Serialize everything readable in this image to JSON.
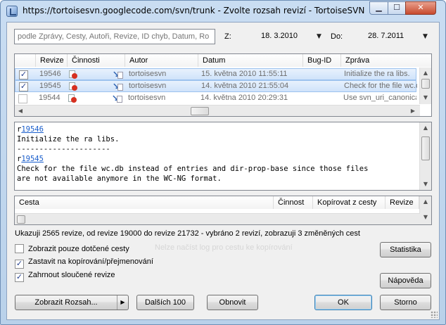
{
  "window": {
    "title": "https://tortoisesvn.googlecode.com/svn/trunk - Zvolte rozsah revizí - TortoiseSVN",
    "min_label": "▁",
    "max_label": "☐",
    "close_label": "✕"
  },
  "filter": {
    "search_placeholder": "podle Zprávy, Cesty, Autoři, Revize, ID chyb, Datum, Ro",
    "from_label": "Z:",
    "from_value": "18.  3.2010",
    "to_label": "Do:",
    "to_value": "28.  7.2011"
  },
  "log_table": {
    "headers": [
      "Revize",
      "Činnosti",
      "Autor",
      "Datum",
      "Bug-ID",
      "Zpráva"
    ],
    "rows": [
      {
        "checked": true,
        "revision": "19546",
        "author": "tortoisesvn",
        "date": "15. května 2010 11:55:11",
        "bugid": "",
        "message": "Initialize the ra libs.",
        "selected": true
      },
      {
        "checked": true,
        "revision": "19545",
        "author": "tortoisesvn",
        "date": "14. května 2010 21:55:04",
        "bugid": "",
        "message": "Check for the file wc.d",
        "selected": true
      },
      {
        "checked": false,
        "revision": "19544",
        "author": "tortoisesvn",
        "date": "14. května 2010 20:29:31",
        "bugid": "",
        "message": "Use svn_uri_canonical",
        "selected": false
      }
    ]
  },
  "message_pane": {
    "lines": [
      {
        "prefix": "r",
        "link": "19546"
      },
      {
        "text": "Initialize the ra libs."
      },
      {
        "text": "---------------------"
      },
      {
        "prefix": "r",
        "link": "19545"
      },
      {
        "text": "Check for the file wc.db instead of entries and dir-prop-base since those files"
      },
      {
        "text": "are not available anymore in the WC-NG format."
      }
    ]
  },
  "paths_table": {
    "headers": [
      "Cesta",
      "Činnost",
      "Kopírovat z cesty",
      "Revize"
    ]
  },
  "status_text": "Ukazuji 2565 revize, od revize 19000 do revize 21732 - vybráno 2 revizí, zobrazuji 3 změněných cest",
  "options": {
    "only_affected": {
      "label": "Zobrazit pouze dotčené cesty",
      "checked": false
    },
    "stop_on_copy": {
      "label": "Zastavit na kopírování/přejmenování",
      "checked": true
    },
    "include_merged": {
      "label": "Zahrnout sloučené revize",
      "checked": true
    }
  },
  "buttons": {
    "statistics": "Statistika",
    "help": "Nápověda",
    "show_range": "Zobrazit Rozsah...",
    "next_100": "Dalších 100",
    "refresh": "Obnovit",
    "ok": "OK",
    "cancel": "Storno"
  },
  "ghost_text": "Nelze načíst log pro cestu ke kopírování"
}
